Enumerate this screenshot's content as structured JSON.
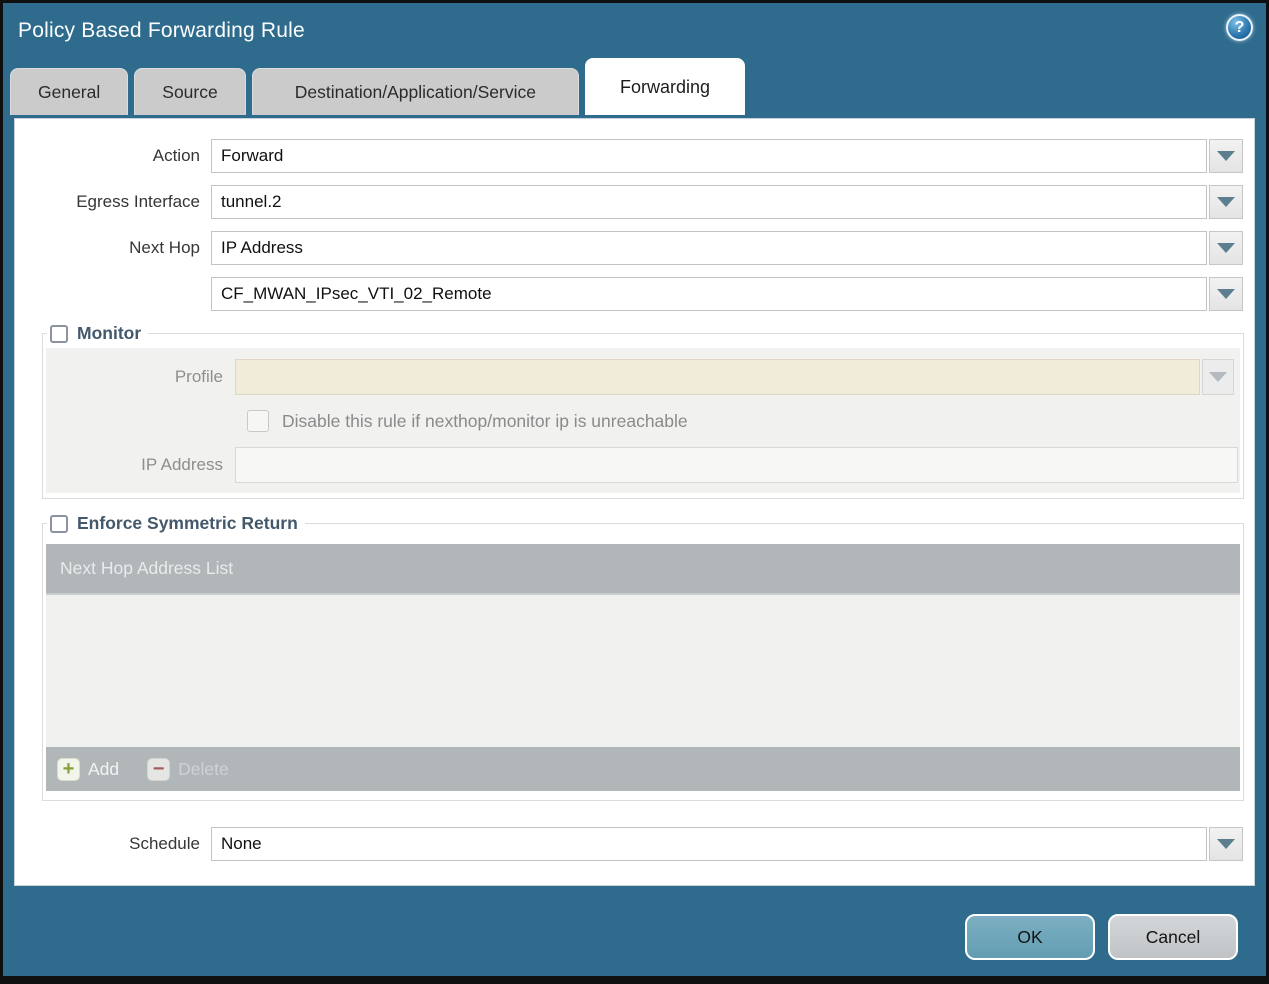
{
  "window": {
    "title": "Policy Based Forwarding Rule",
    "help_icon_glyph": "?"
  },
  "tabs": [
    {
      "label": "General",
      "active": false
    },
    {
      "label": "Source",
      "active": false
    },
    {
      "label": "Destination/Application/Service",
      "active": false
    },
    {
      "label": "Forwarding",
      "active": true
    }
  ],
  "form": {
    "action": {
      "label": "Action",
      "value": "Forward"
    },
    "egress_interface": {
      "label": "Egress Interface",
      "value": "tunnel.2"
    },
    "next_hop": {
      "label": "Next Hop",
      "value": "IP Address"
    },
    "next_hop_address": {
      "value": "CF_MWAN_IPsec_VTI_02_Remote"
    },
    "schedule": {
      "label": "Schedule",
      "value": "None"
    }
  },
  "monitor": {
    "legend": "Monitor",
    "checked": false,
    "profile": {
      "label": "Profile",
      "value": ""
    },
    "disable_rule_label": "Disable this rule if nexthop/monitor ip is unreachable",
    "disable_rule_checked": false,
    "ip_address": {
      "label": "IP Address",
      "value": ""
    }
  },
  "symmetric_return": {
    "legend": "Enforce Symmetric Return",
    "checked": false,
    "table_header": "Next Hop Address List",
    "rows": [],
    "add_label": "Add",
    "delete_label": "Delete",
    "add_icon_glyph": "+",
    "delete_icon_glyph": "−"
  },
  "footer_buttons": {
    "ok": "OK",
    "cancel": "Cancel"
  },
  "colors": {
    "titlebar_teal": "#2e6b8c",
    "active_tab": "#ffffff",
    "inactive_tab": "#cbcbcb",
    "profile_disabled_field": "#f1ecd9",
    "panel_gray": "#f1f1f0",
    "table_bar_gray": "#b1b6b9",
    "ok_button": "#6da5b9",
    "cancel_button": "#c6c9cb",
    "legend_text": "#44586b",
    "add_plus_green": "#84a035",
    "delete_minus_red": "#a25a5a"
  }
}
